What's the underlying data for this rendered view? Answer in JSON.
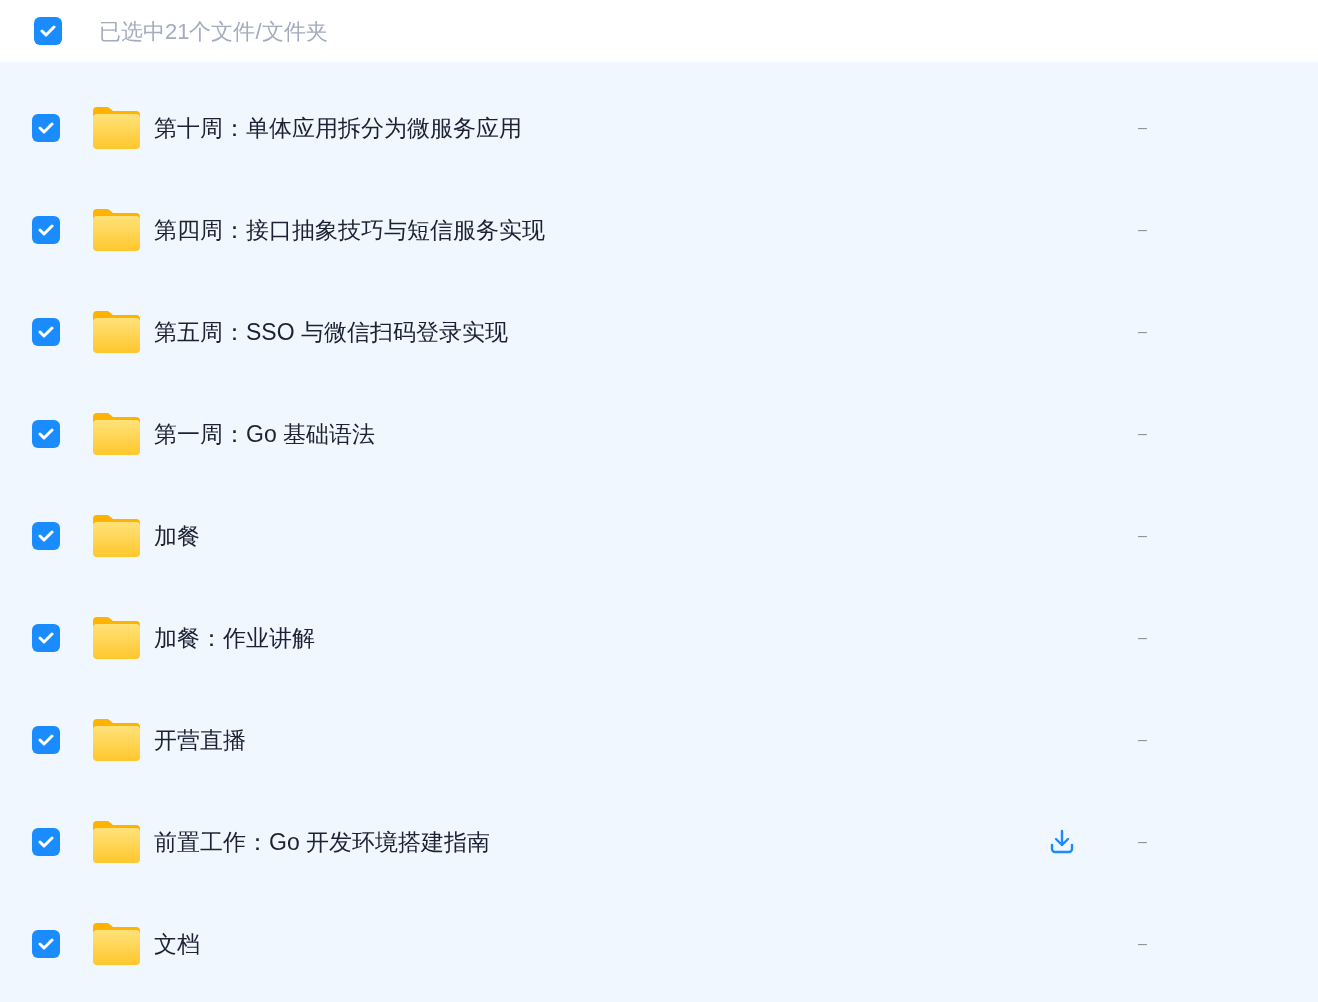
{
  "header": {
    "checked": true,
    "label": "已选中21个文件/文件夹"
  },
  "rows": [
    {
      "name": "第十周：单体应用拆分为微服务应用",
      "checked": true,
      "download": false,
      "size": "–"
    },
    {
      "name": "第四周：接口抽象技巧与短信服务实现",
      "checked": true,
      "download": false,
      "size": "–"
    },
    {
      "name": "第五周：SSO 与微信扫码登录实现",
      "checked": true,
      "download": false,
      "size": "–"
    },
    {
      "name": "第一周：Go 基础语法",
      "checked": true,
      "download": false,
      "size": "–"
    },
    {
      "name": "加餐",
      "checked": true,
      "download": false,
      "size": "–"
    },
    {
      "name": "加餐：作业讲解",
      "checked": true,
      "download": false,
      "size": "–"
    },
    {
      "name": "开营直播",
      "checked": true,
      "download": false,
      "size": "–"
    },
    {
      "name": "前置工作：Go 开发环境搭建指南",
      "checked": true,
      "download": true,
      "size": "–"
    },
    {
      "name": "文档",
      "checked": true,
      "download": false,
      "size": "–"
    }
  ]
}
